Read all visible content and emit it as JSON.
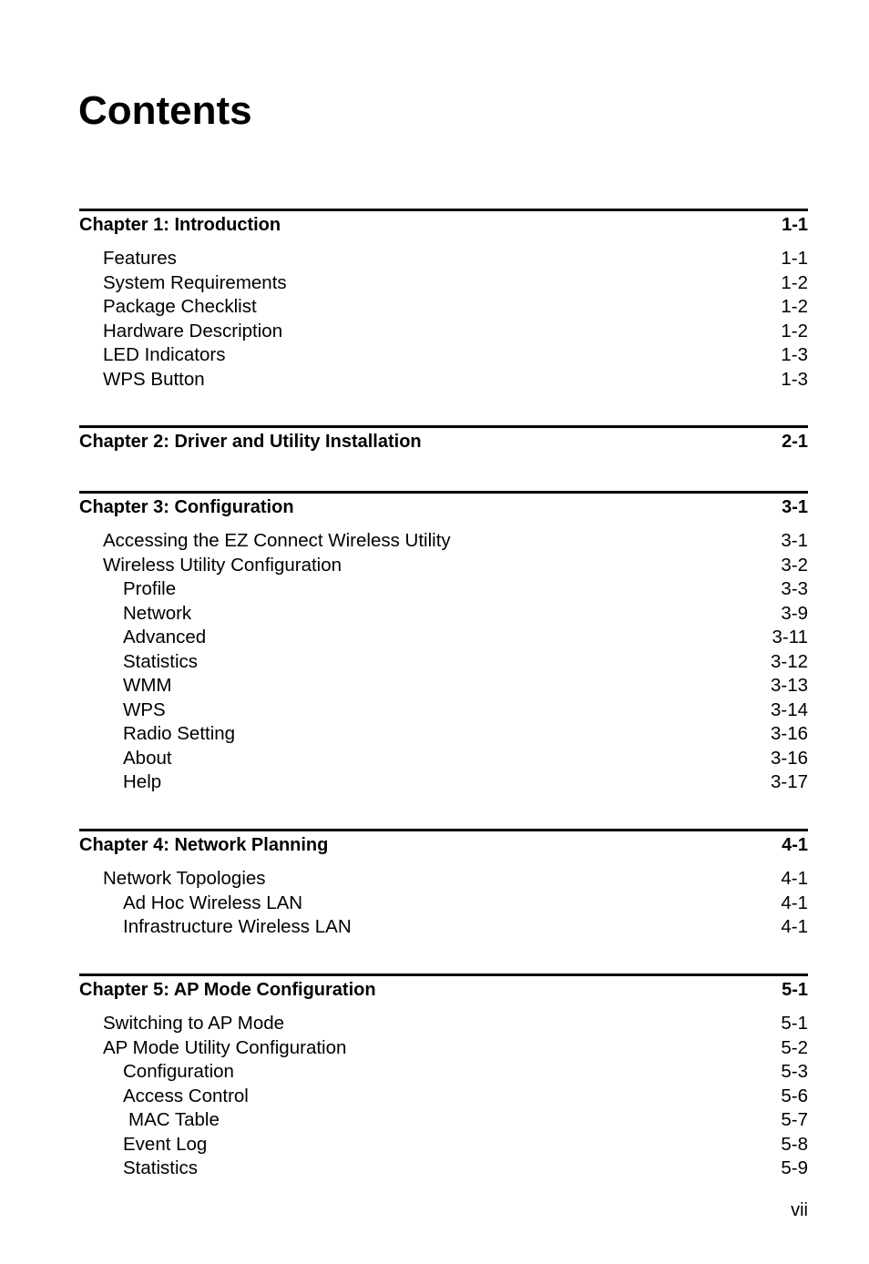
{
  "title": "Contents",
  "chapters": [
    {
      "label": "Chapter 1: Introduction",
      "page": "1-1",
      "entries": [
        {
          "label": "Features",
          "page": "1-1",
          "level": 1
        },
        {
          "label": "System Requirements",
          "page": "1-2",
          "level": 1
        },
        {
          "label": "Package Checklist",
          "page": "1-2",
          "level": 1
        },
        {
          "label": "Hardware Description",
          "page": "1-2",
          "level": 1
        },
        {
          "label": "LED Indicators",
          "page": "1-3",
          "level": 1
        },
        {
          "label": "WPS Button",
          "page": "1-3",
          "level": 1
        }
      ]
    },
    {
      "label": "Chapter 2: Driver and Utility Installation",
      "page": "2-1",
      "entries": []
    },
    {
      "label": "Chapter 3: Configuration",
      "page": "3-1",
      "entries": [
        {
          "label": "Accessing the EZ Connect Wireless Utility",
          "page": "3-1",
          "level": 1
        },
        {
          "label": "Wireless Utility Configuration",
          "page": "3-2",
          "level": 1
        },
        {
          "label": "Profile",
          "page": "3-3",
          "level": 2
        },
        {
          "label": "Network",
          "page": "3-9",
          "level": 2
        },
        {
          "label": "Advanced",
          "page": "3-11",
          "level": 2
        },
        {
          "label": "Statistics",
          "page": "3-12",
          "level": 2
        },
        {
          "label": "WMM",
          "page": "3-13",
          "level": 2
        },
        {
          "label": "WPS",
          "page": "3-14",
          "level": 2
        },
        {
          "label": "Radio Setting",
          "page": "3-16",
          "level": 2
        },
        {
          "label": "About",
          "page": "3-16",
          "level": 2
        },
        {
          "label": "Help",
          "page": "3-17",
          "level": 2
        }
      ]
    },
    {
      "label": "Chapter 4: Network Planning",
      "page": "4-1",
      "entries": [
        {
          "label": "Network Topologies",
          "page": "4-1",
          "level": 1
        },
        {
          "label": "Ad Hoc Wireless LAN",
          "page": "4-1",
          "level": 2
        },
        {
          "label": "Infrastructure Wireless LAN",
          "page": "4-1",
          "level": 2
        }
      ]
    },
    {
      "label": "Chapter 5: AP Mode Configuration",
      "page": "5-1",
      "entries": [
        {
          "label": "Switching to AP Mode",
          "page": "5-1",
          "level": 1
        },
        {
          "label": "AP Mode Utility Configuration",
          "page": "5-2",
          "level": 1
        },
        {
          "label": "Configuration",
          "page": "5-3",
          "level": 2
        },
        {
          "label": "Access Control",
          "page": "5-6",
          "level": 2
        },
        {
          "label": "MAC Table",
          "page": "5-7",
          "level": 3
        },
        {
          "label": "Event Log",
          "page": "5-8",
          "level": 2
        },
        {
          "label": "Statistics",
          "page": "5-9",
          "level": 2
        }
      ]
    }
  ],
  "footer": {
    "page_number": "vii"
  }
}
